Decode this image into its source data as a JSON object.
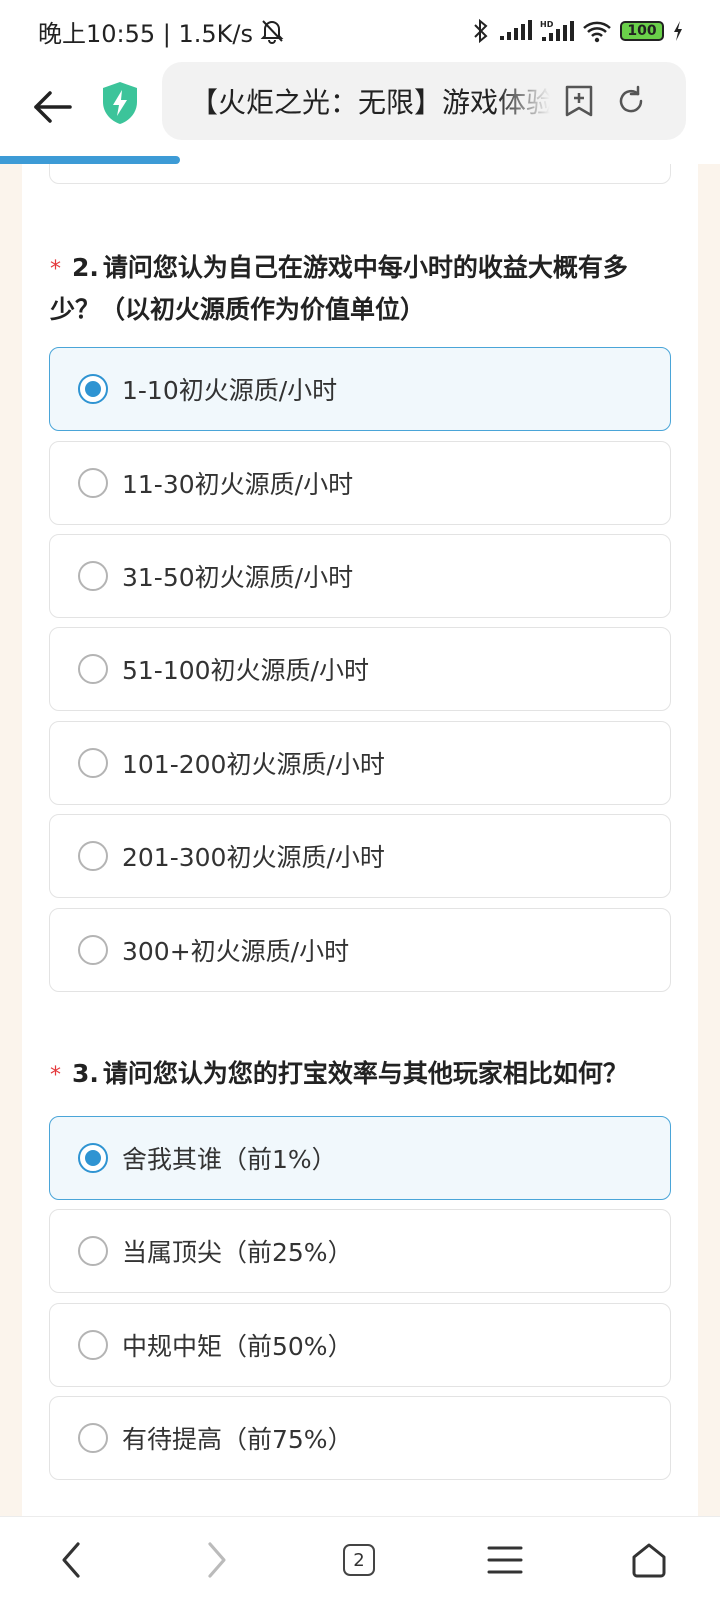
{
  "status_bar": {
    "time_speed": "晚上10:55 | 1.5K/s",
    "battery": "100"
  },
  "browser": {
    "url_title": "【火炬之光：无限】游戏体验调查问卷",
    "progress": 0.25,
    "tab_count": "2"
  },
  "questions": [
    {
      "required_mark": "*",
      "number": "2.",
      "text": "请问您认为自己在游戏中每小时的收益大概有多少？（以初火源质作为价值单位）",
      "options": [
        {
          "label": "1-10初火源质/小时",
          "selected": true
        },
        {
          "label": "11-30初火源质/小时",
          "selected": false
        },
        {
          "label": "31-50初火源质/小时",
          "selected": false
        },
        {
          "label": "51-100初火源质/小时",
          "selected": false
        },
        {
          "label": "101-200初火源质/小时",
          "selected": false
        },
        {
          "label": "201-300初火源质/小时",
          "selected": false
        },
        {
          "label": "300+初火源质/小时",
          "selected": false
        }
      ]
    },
    {
      "required_mark": "*",
      "number": "3.",
      "text": "请问您认为您的打宝效率与其他玩家相比如何？",
      "options": [
        {
          "label": "舍我其谁（前1%）",
          "selected": true
        },
        {
          "label": "当属顶尖（前25%）",
          "selected": false
        },
        {
          "label": "中规中矩（前50%）",
          "selected": false
        },
        {
          "label": "有待提高（前75%）",
          "selected": false
        }
      ]
    }
  ],
  "colors": {
    "accent": "#2f94d2",
    "selected_bg": "#f1f8fc",
    "required": "#e4393c",
    "page_bg": "#fbf4ec"
  },
  "icons": [
    "back-arrow-icon",
    "shield-icon",
    "add-bookmark-icon",
    "refresh-icon",
    "nav-back-icon",
    "nav-forward-icon",
    "tabs-icon",
    "menu-icon",
    "home-icon",
    "bluetooth-icon",
    "signal-icon",
    "wifi-icon",
    "battery-icon",
    "mute-bell-icon"
  ]
}
